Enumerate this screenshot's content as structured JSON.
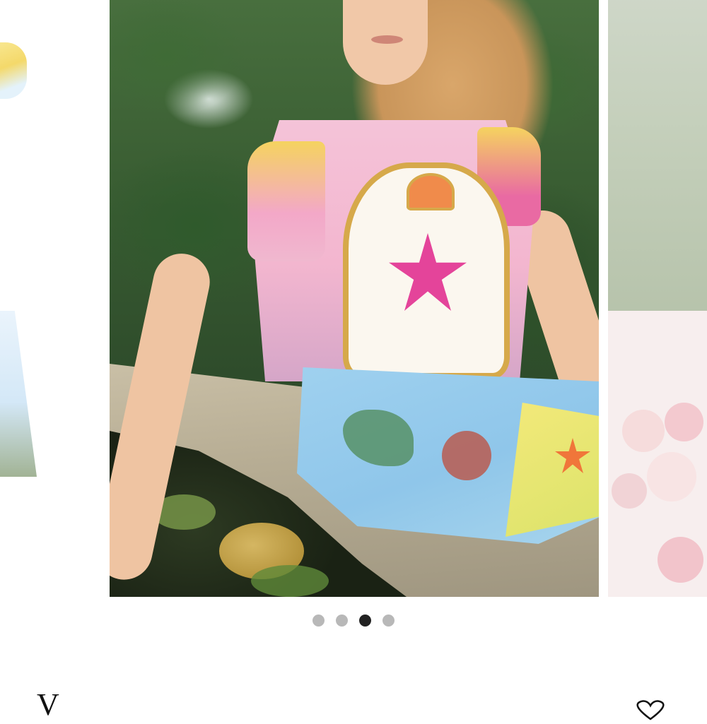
{
  "carousel": {
    "slides": [
      "previous-product-image",
      "main-product-image",
      "next-product-image"
    ],
    "total_slides": 4,
    "active_slide": 3
  },
  "product": {
    "brand_initial": "V"
  },
  "icons": {
    "wishlist": "heart-icon"
  },
  "colors": {
    "dot_inactive": "#b8b8b8",
    "dot_active": "#222222",
    "background": "#ffffff"
  }
}
